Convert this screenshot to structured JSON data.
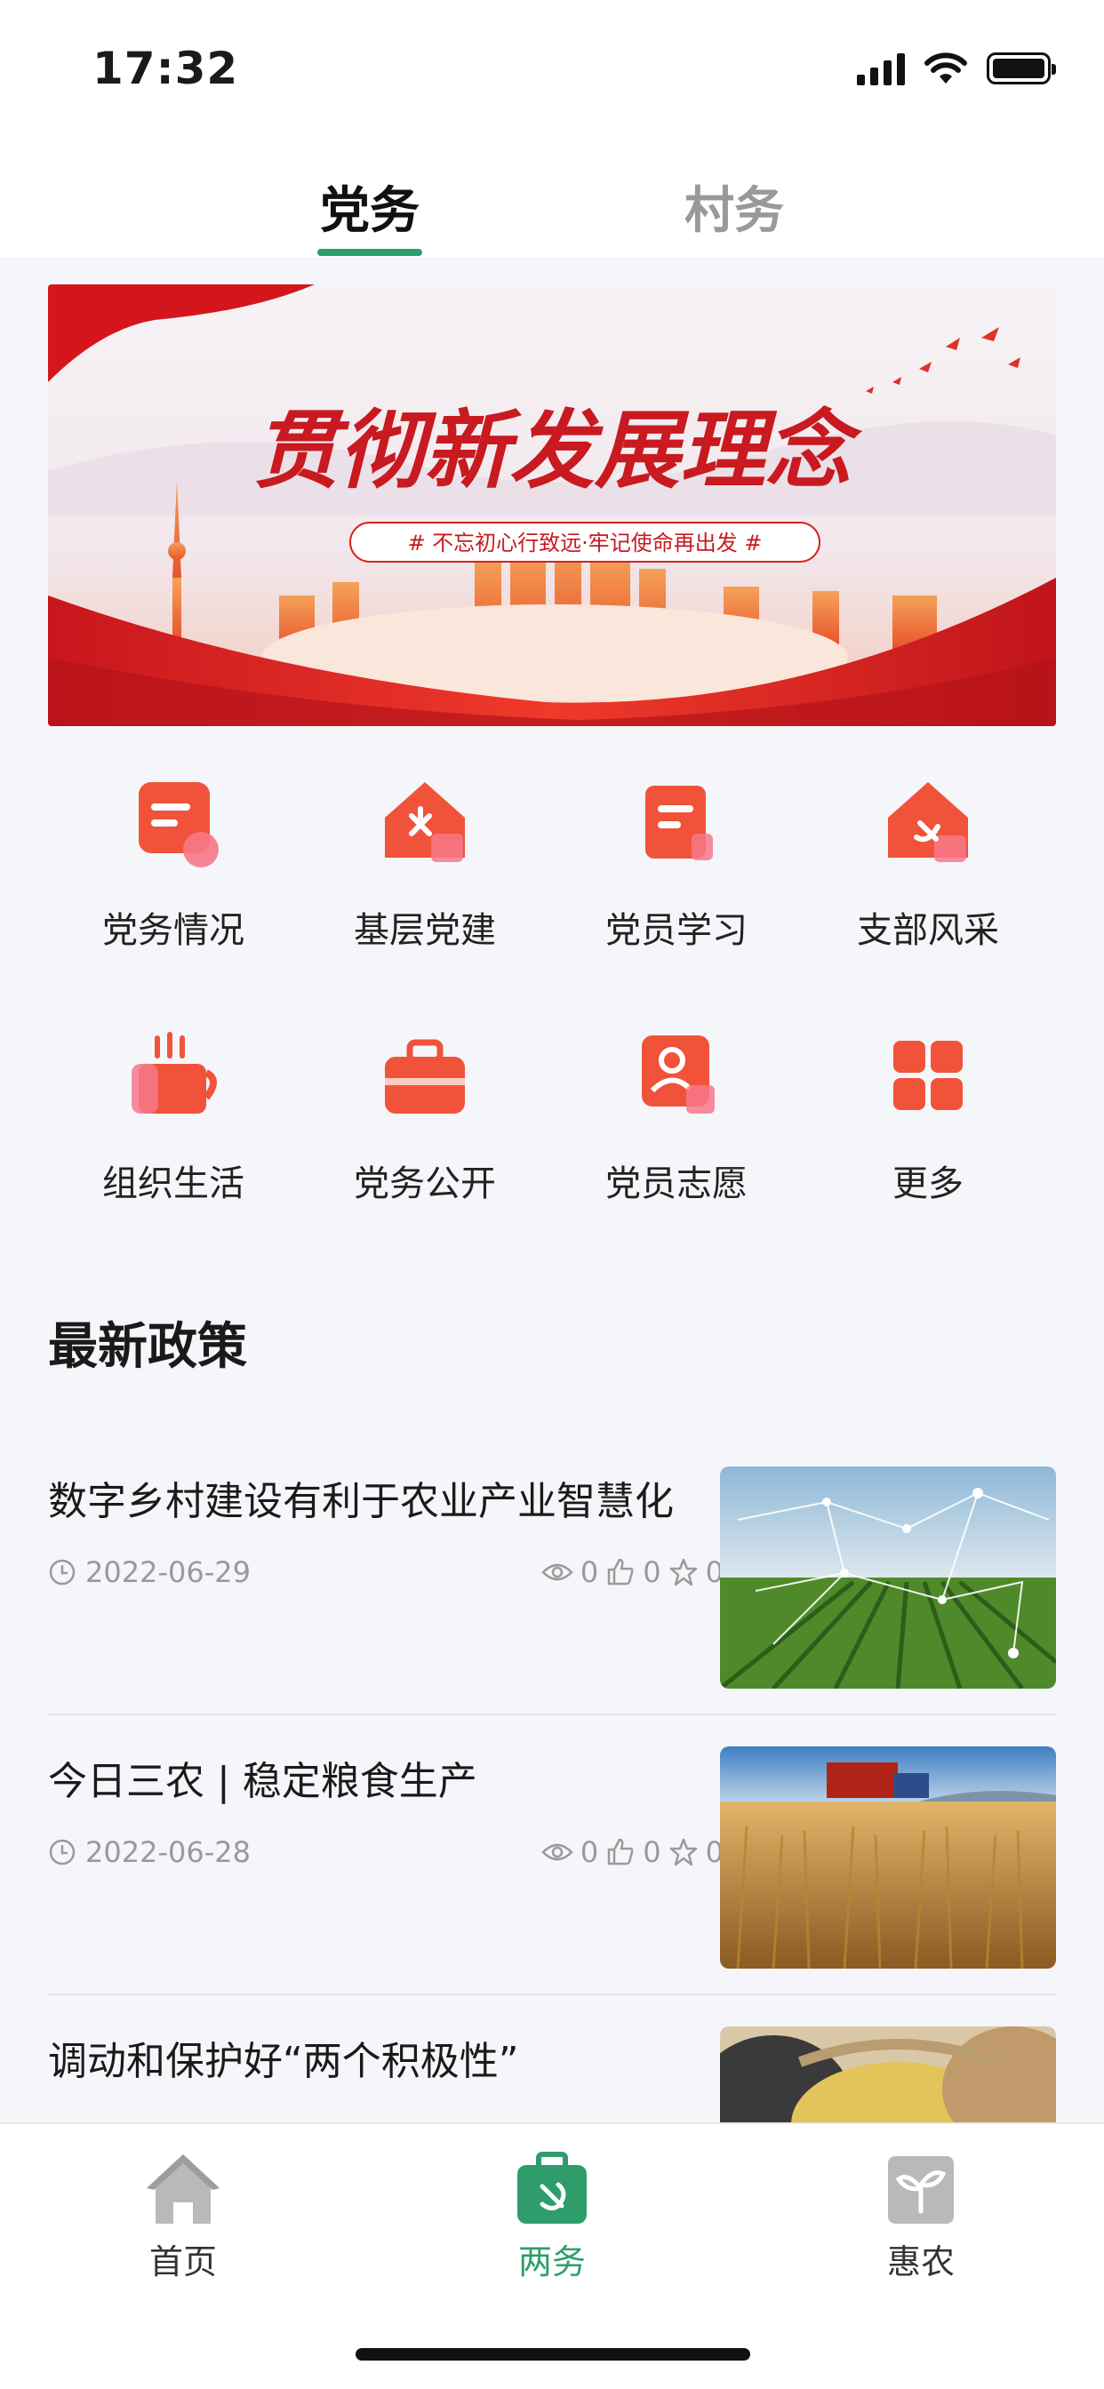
{
  "status_bar": {
    "time": "17:32"
  },
  "tabs": [
    {
      "label": "党务",
      "active": true
    },
    {
      "label": "村务",
      "active": false
    }
  ],
  "banner": {
    "headline": "贯彻新发展理念",
    "slogan": "# 不忘初心行致远·牢记使命再出发 #"
  },
  "grid": [
    {
      "label": "党务情况",
      "icon": "document-icon"
    },
    {
      "label": "基层党建",
      "icon": "party-house-icon"
    },
    {
      "label": "党员学习",
      "icon": "study-icon"
    },
    {
      "label": "支部风采",
      "icon": "branch-house-icon"
    },
    {
      "label": "组织生活",
      "icon": "cup-icon"
    },
    {
      "label": "党务公开",
      "icon": "briefcase-icon"
    },
    {
      "label": "党员志愿",
      "icon": "volunteer-icon"
    },
    {
      "label": "更多",
      "icon": "more-grid-icon"
    }
  ],
  "section_title": "最新政策",
  "news": [
    {
      "title": "数字乡村建设有利于农业产业智慧化",
      "date": "2022-06-29",
      "views": "0",
      "likes": "0",
      "favorites": "0"
    },
    {
      "title": "今日三农 | 稳定粮食生产",
      "date": "2022-06-28",
      "views": "0",
      "likes": "0",
      "favorites": "0"
    },
    {
      "title": "调动和保护好“两个积极性”",
      "date": "",
      "views": "",
      "likes": "",
      "favorites": ""
    }
  ],
  "bottom_nav": [
    {
      "label": "首页",
      "active": false
    },
    {
      "label": "两务",
      "active": true
    },
    {
      "label": "惠农",
      "active": false
    }
  ],
  "colors": {
    "accent": "#2e9d6b",
    "icon_orange": "#f0533a",
    "banner_red": "#d9221b"
  }
}
